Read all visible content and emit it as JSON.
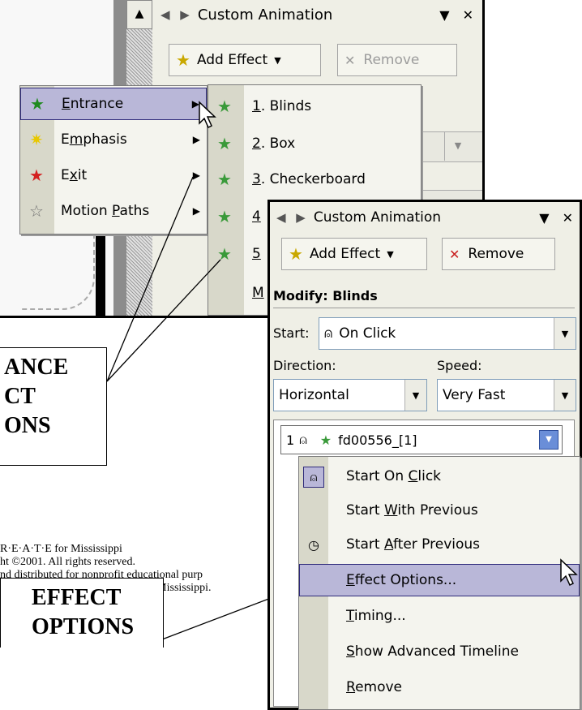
{
  "pane1": {
    "title": "Custom Animation",
    "add_effect": "Add Effect",
    "remove": "Remove"
  },
  "main_menu": {
    "items": [
      {
        "pre": "",
        "u": "E",
        "post": "ntrance",
        "icon": "entrance-star-icon"
      },
      {
        "pre": "E",
        "u": "m",
        "post": "phasis",
        "icon": "emphasis-star-icon"
      },
      {
        "pre": "E",
        "u": "x",
        "post": "it",
        "icon": "exit-star-icon"
      },
      {
        "pre": "Motion ",
        "u": "P",
        "post": "aths",
        "icon": "motion-path-star-icon"
      }
    ]
  },
  "entrance_menu": {
    "items": [
      {
        "num": "1",
        "rest": ". Blinds"
      },
      {
        "num": "2",
        "rest": ". Box"
      },
      {
        "num": "3",
        "rest": ". Checkerboard"
      },
      {
        "num": "4",
        "rest": ""
      },
      {
        "num": "5",
        "rest": ""
      },
      {
        "num": "M",
        "rest": ""
      }
    ]
  },
  "callout_entrance": [
    "ANCE",
    "CT",
    "ONS"
  ],
  "callout_effect": [
    "EFFECT",
    "OPTIONS"
  ],
  "footer": {
    "line1": "R·E·A·T·E for Mississippi",
    "line2": "ht ©2001.  All rights reserved.",
    "line3": "nd distributed for nonprofit educational purp",
    "line4": "or Mississippi."
  },
  "pane2": {
    "title": "Custom Animation",
    "add_effect": "Add Effect",
    "remove": "Remove",
    "modify": "Modify: Blinds",
    "start_label": "Start:",
    "start_value": "On Click",
    "direction_label": "Direction:",
    "direction_value": "Horizontal",
    "speed_label": "Speed:",
    "speed_value": "Very Fast",
    "list_item": {
      "order": "1",
      "name": "fd00556_[1]"
    }
  },
  "context_menu": {
    "items": [
      {
        "pre": "Start On ",
        "u": "C",
        "post": "lick",
        "icon": "mouse-click-icon"
      },
      {
        "pre": "Start ",
        "u": "W",
        "post": "ith Previous",
        "icon": ""
      },
      {
        "pre": "Start ",
        "u": "A",
        "post": "fter Previous",
        "icon": "clock-icon"
      },
      {
        "pre": "",
        "u": "E",
        "post": "ffect Options...",
        "icon": ""
      },
      {
        "pre": "",
        "u": "T",
        "post": "iming...",
        "icon": ""
      },
      {
        "pre": "",
        "u": "S",
        "post": "how Advanced Timeline",
        "icon": ""
      },
      {
        "pre": "",
        "u": "R",
        "post": "emove",
        "icon": ""
      }
    ]
  },
  "colors": {
    "menu_highlight": "#b9b7d8",
    "pane_bg": "#efefe6",
    "gutter": "#d8d8ca"
  }
}
